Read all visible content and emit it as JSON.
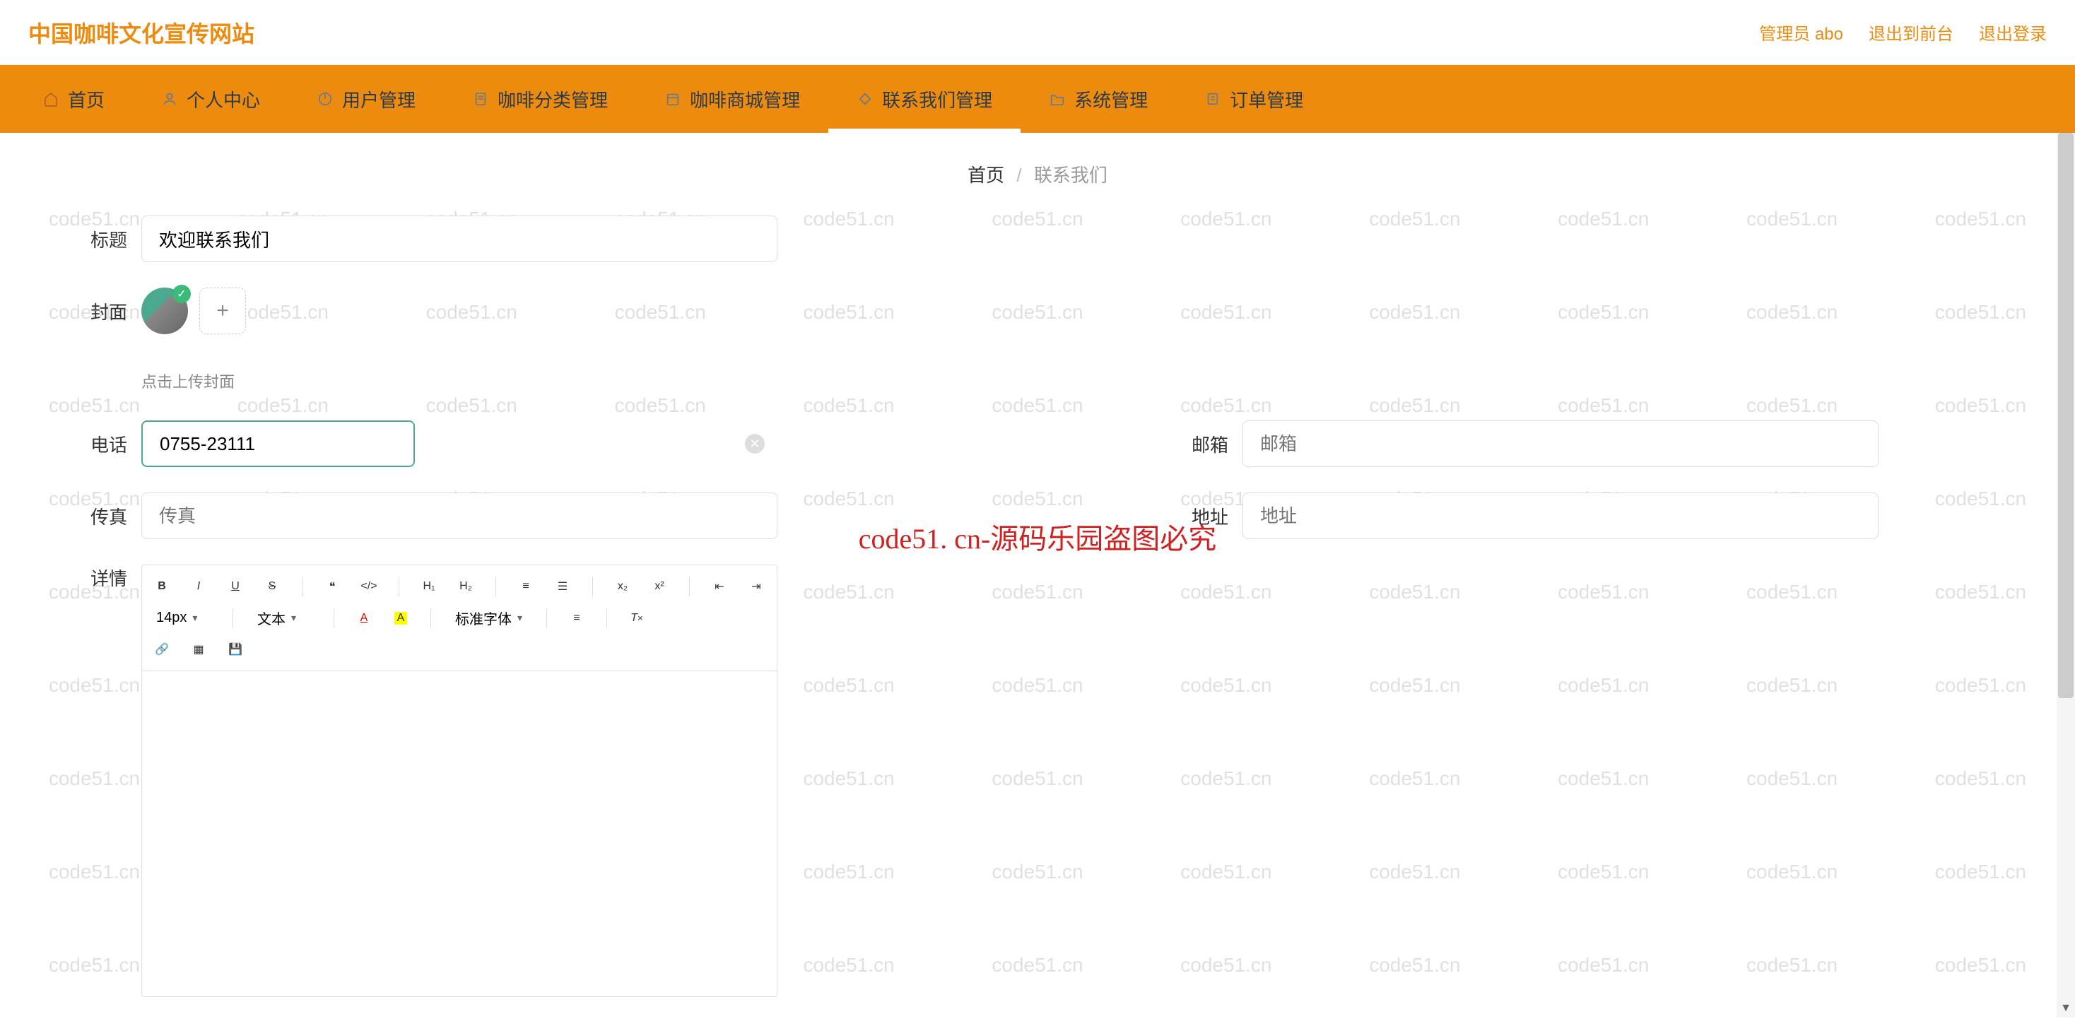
{
  "header": {
    "site_title": "中国咖啡文化宣传网站",
    "admin_label": "管理员 abo",
    "exit_front": "退出到前台",
    "logout": "退出登录"
  },
  "nav": {
    "items": [
      {
        "label": "首页"
      },
      {
        "label": "个人中心"
      },
      {
        "label": "用户管理"
      },
      {
        "label": "咖啡分类管理"
      },
      {
        "label": "咖啡商城管理"
      },
      {
        "label": "联系我们管理"
      },
      {
        "label": "系统管理"
      },
      {
        "label": "订单管理"
      }
    ]
  },
  "breadcrumb": {
    "root": "首页",
    "current": "联系我们"
  },
  "form": {
    "title_label": "标题",
    "title_value": "欢迎联系我们",
    "cover_label": "封面",
    "upload_hint": "点击上传封面",
    "phone_label": "电话",
    "phone_value": "0755-23111",
    "email_label": "邮箱",
    "email_placeholder": "邮箱",
    "fax_label": "传真",
    "fax_placeholder": "传真",
    "address_label": "地址",
    "address_placeholder": "地址",
    "detail_label": "详情"
  },
  "editor": {
    "font_size": "14px",
    "text_style": "文本",
    "font_family": "标准字体"
  },
  "watermark": "code51.cn",
  "center_watermark": "code51. cn-源码乐园盗图必究"
}
